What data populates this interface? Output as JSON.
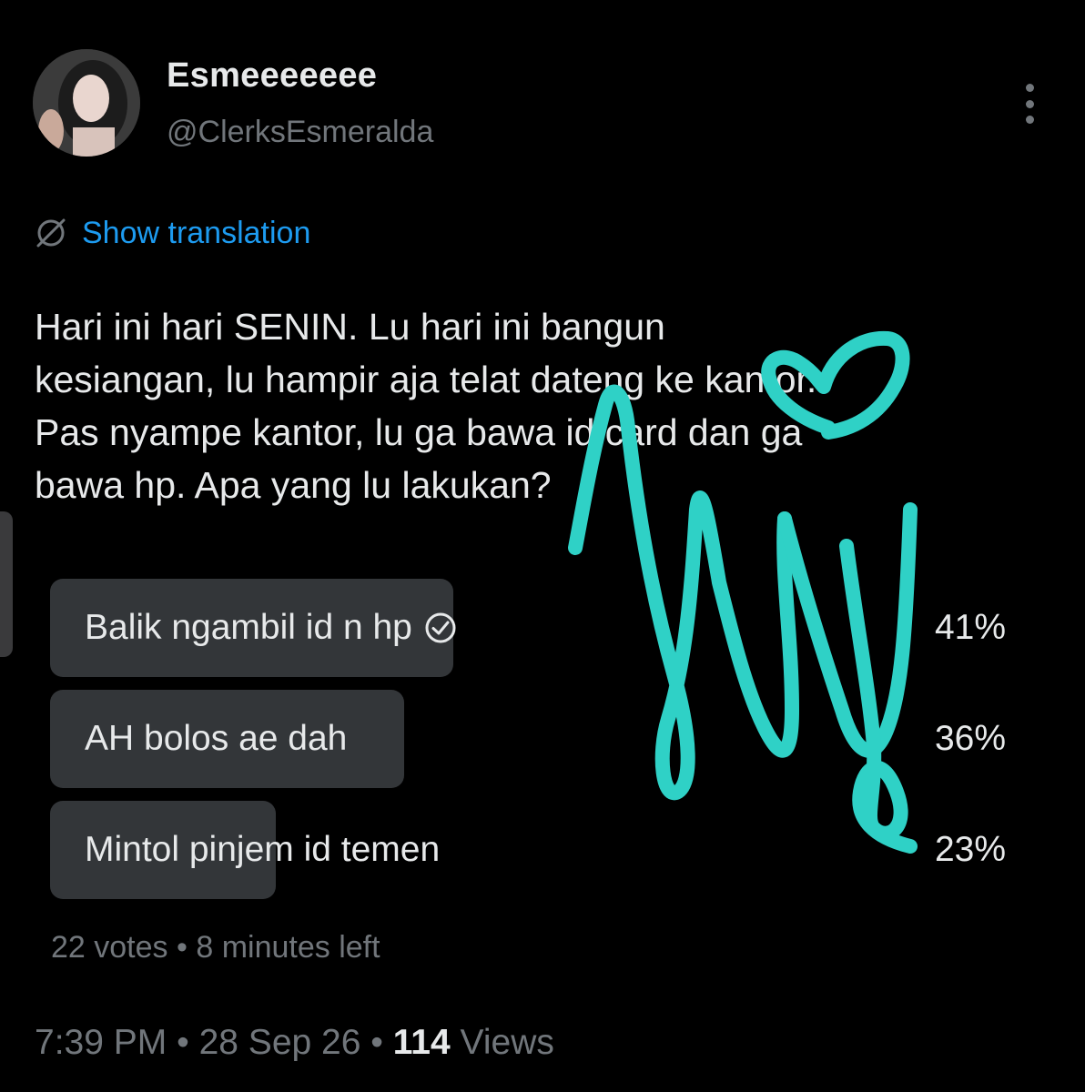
{
  "author": {
    "display_name": "Esmeeeeeee",
    "handle": "@ClerksEsmeralda"
  },
  "translate_label": "Show translation",
  "tweet_lines": [
    "Hari ini hari SENIN. Lu hari ini bangun",
    "kesiangan, lu hampir aja telat dateng ke kantor.",
    "Pas nyampe kantor, lu ga bawa id card dan ga",
    "bawa hp. Apa yang lu lakukan?"
  ],
  "poll": {
    "options": [
      {
        "label": "Balik ngambil id n hp",
        "percent": "41%",
        "fraction": 0.41,
        "selected": true
      },
      {
        "label": "AH bolos ae dah",
        "percent": "36%",
        "fraction": 0.36,
        "selected": false
      },
      {
        "label": "Mintol pinjem id temen",
        "percent": "23%",
        "fraction": 0.23,
        "selected": false
      }
    ],
    "votes": "22 votes",
    "separator": "•",
    "time_left": "8 minutes left"
  },
  "meta": {
    "time": "7:39 PM",
    "date": "28 Sep 26",
    "views_count": "114",
    "views_label": "Views",
    "separator": "•"
  },
  "colors": {
    "background": "#000000",
    "text": "#e7e9ea",
    "muted": "#71767b",
    "link": "#1d9bf0",
    "poll_bar": "#333639",
    "scribble": "#2fd1c6"
  },
  "icons": {
    "more": "vertical-ellipsis-icon",
    "translate": "translate-globe-icon",
    "selected": "check-circle-icon"
  }
}
